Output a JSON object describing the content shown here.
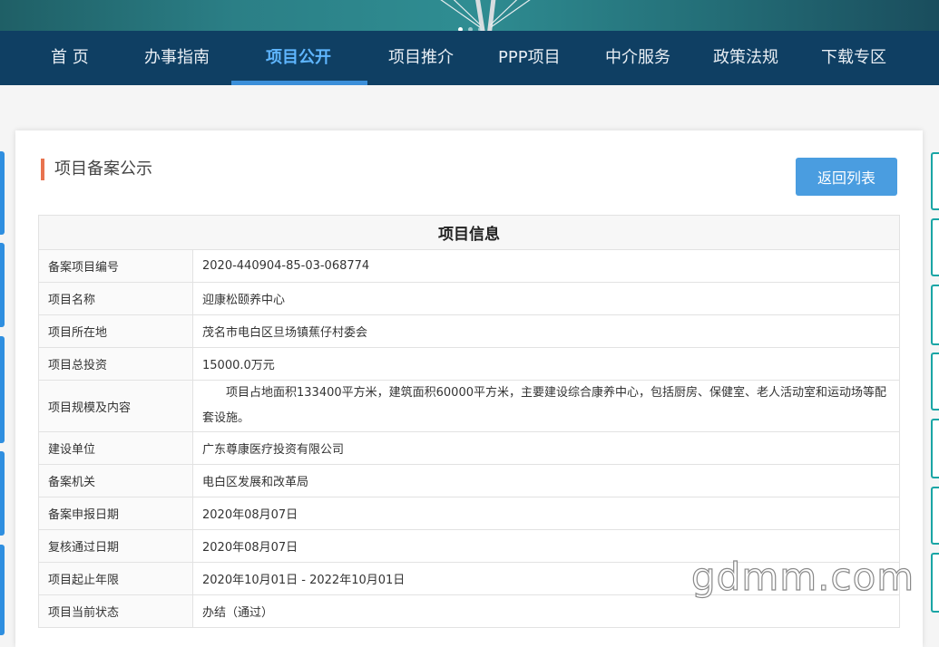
{
  "nav": {
    "items": [
      {
        "label": "首 页"
      },
      {
        "label": "办事指南"
      },
      {
        "label": "项目公开"
      },
      {
        "label": "项目推介"
      },
      {
        "label": "PPP项目"
      },
      {
        "label": "中介服务"
      },
      {
        "label": "政策法规"
      },
      {
        "label": "下载专区"
      }
    ],
    "active_index": 2
  },
  "section": {
    "title": "项目备案公示",
    "back_label": "返回列表"
  },
  "info": {
    "header": "项目信息",
    "rows": [
      {
        "label": "备案项目编号",
        "value": "2020-440904-85-03-068774"
      },
      {
        "label": "项目名称",
        "value": "迎康松颐养中心"
      },
      {
        "label": "项目所在地",
        "value": "茂名市电白区旦场镇蕉仔村委会"
      },
      {
        "label": "项目总投资",
        "value": "15000.0万元"
      },
      {
        "label": "项目规模及内容",
        "value": "项目占地面积133400平方米，建筑面积60000平方米，主要建设综合康养中心，包括厨房、保健室、老人活动室和运动场等配套设施。"
      },
      {
        "label": "建设单位",
        "value": "广东尊康医疗投资有限公司"
      },
      {
        "label": "备案机关",
        "value": "电白区发展和改革局"
      },
      {
        "label": "备案申报日期",
        "value": "2020年08月07日"
      },
      {
        "label": "复核通过日期",
        "value": "2020年08月07日"
      },
      {
        "label": "项目起止年限",
        "value": "2020年10月01日 - 2022年10月01日"
      },
      {
        "label": "项目当前状态",
        "value": "办结（通过）"
      }
    ]
  },
  "watermark": "gdmm.com",
  "colors": {
    "nav_bg": "#0f3f63",
    "nav_active": "#5fb6ff",
    "accent_bar": "#e8734f",
    "button": "#4a9de0"
  }
}
